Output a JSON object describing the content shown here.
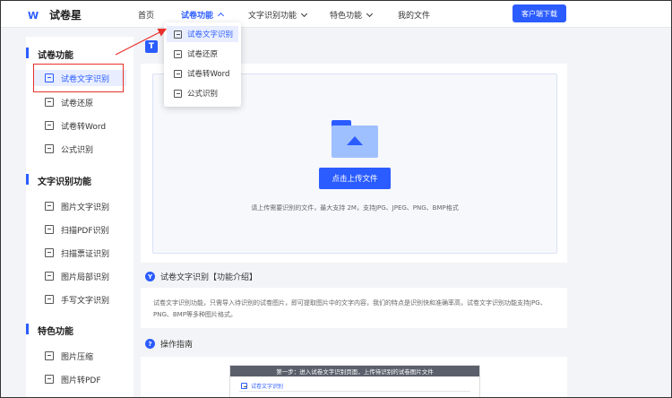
{
  "header": {
    "logo_text": "试卷星",
    "nav": [
      {
        "label": "首页"
      },
      {
        "label": "试卷功能"
      },
      {
        "label": "文字识别功能"
      },
      {
        "label": "特色功能"
      },
      {
        "label": "我的文件"
      }
    ],
    "download_label": "客户端下载"
  },
  "dropdown": {
    "items": [
      {
        "label": "试卷文字识别"
      },
      {
        "label": "试卷还原"
      },
      {
        "label": "试卷转Word"
      },
      {
        "label": "公式识别"
      }
    ]
  },
  "sidebar": {
    "sections": [
      {
        "title": "试卷功能",
        "items": [
          "试卷文字识别",
          "试卷还原",
          "试卷转Word",
          "公式识别"
        ]
      },
      {
        "title": "文字识别功能",
        "items": [
          "图片文字识别",
          "扫描PDF识别",
          "扫描票证识别",
          "图片局部识别",
          "手写文字识别"
        ]
      },
      {
        "title": "特色功能",
        "items": [
          "图片压缩",
          "图片转PDF"
        ]
      }
    ]
  },
  "main": {
    "page_icon": "T",
    "upload_button": "点击上传文件",
    "upload_hint": "请上传需要识别的文件，最大支持 2M，支持JPG、JPEG、PNG、BMP格式",
    "intro_title": "试卷文字识别【功能介绍】",
    "intro_icon": "Y",
    "intro_text": "试卷文字识别功能，只需导入待识别的试卷图片，即可提取图片中的文字内容，我们的特点是识别快和准确率高，试卷文字识别功能支持JPG、PNG、BMP等多种图片格式。",
    "guide_title": "操作指南",
    "guide_icon": "?",
    "guide_step": "第一步：进入试卷文字识别页面，上传待识别的试卷图片文件",
    "guide_sub": "试卷文字识别"
  },
  "colors": {
    "accent": "#2b5cff",
    "annotation": "#e8302c"
  }
}
